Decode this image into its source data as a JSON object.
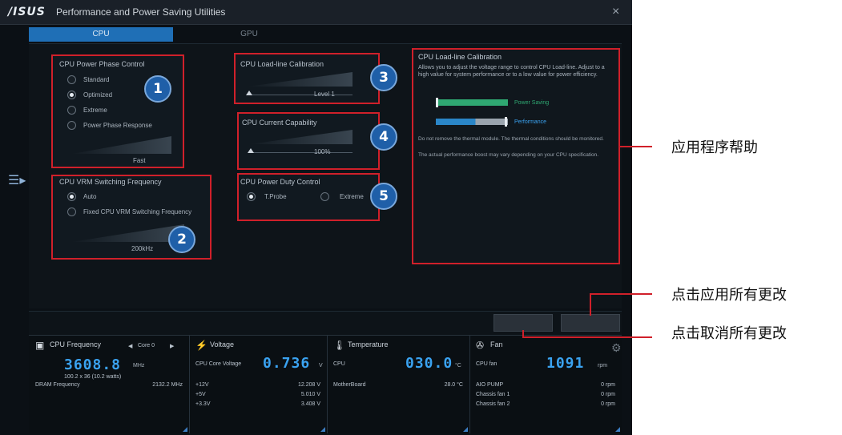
{
  "window": {
    "logo": "/ISUS",
    "title": "Performance and Power Saving Utilities",
    "close_glyph": "×"
  },
  "tabs": [
    {
      "label": "CPU",
      "active": true
    },
    {
      "label": "GPU",
      "active": false
    }
  ],
  "side_toggle_icon": "menu-expand-icon",
  "panels": {
    "phase_control": {
      "title": "CPU Power Phase Control",
      "options": [
        "Standard",
        "Optimized",
        "Extreme",
        "Power Phase Response"
      ],
      "selected": "Optimized",
      "slider_value": "Fast",
      "badge": "1"
    },
    "vrm_frequency": {
      "title": "CPU VRM Switching Frequency",
      "options": [
        "Auto",
        "Fixed CPU VRM Switching Frequency"
      ],
      "selected": "Auto",
      "slider_value": "200kHz",
      "badge": "2"
    },
    "load_line": {
      "title": "CPU Load-line Calibration",
      "slider_value": "Level 1",
      "badge": "3"
    },
    "current_capability": {
      "title": "CPU Current Capability",
      "slider_value": "100%",
      "badge": "4"
    },
    "duty_control": {
      "title": "CPU Power Duty Control",
      "options": [
        "T.Probe",
        "Extreme"
      ],
      "selected": "T.Probe",
      "badge": "5"
    }
  },
  "help": {
    "title": "CPU Load-line Calibration",
    "text": "Allows you to adjust the voltage range to control CPU Load-line. Adjust to a high value for system performance or to a low value for power efficiency.",
    "bar1_label": "Power Saving",
    "bar2_label": "Performance",
    "note1": "Do not remove the thermal module. The thermal conditions should be monitored.",
    "note2": "The actual performance boost may vary depending on your CPU specification.",
    "colors": {
      "power_saving": "#2fa872",
      "performance": "#2a86c8"
    }
  },
  "stats": {
    "cpu_freq": {
      "title": "CPU Frequency",
      "core_select": "Core 0",
      "value": "3608.8",
      "unit": "MHz",
      "sub": "100.2 x 36 (10.2 watts)",
      "rows": [
        {
          "label": "DRAM Frequency",
          "value": "2132.2 MHz"
        }
      ]
    },
    "voltage": {
      "title": "Voltage",
      "main_label": "CPU Core Voltage",
      "value": "0.736",
      "unit": "V",
      "rows": [
        {
          "label": "+12V",
          "value": "12.208 V"
        },
        {
          "label": "+5V",
          "value": "5.010 V"
        },
        {
          "label": "+3.3V",
          "value": "3.408 V"
        }
      ]
    },
    "temperature": {
      "title": "Temperature",
      "main_label": "CPU",
      "value": "030.0",
      "unit": "°C",
      "rows": [
        {
          "label": "MotherBoard",
          "value": "28.0 °C"
        }
      ]
    },
    "fan": {
      "title": "Fan",
      "main_label": "CPU fan",
      "value": "1091",
      "unit": "rpm",
      "rows": [
        {
          "label": "AIO PUMP",
          "value": "0 rpm"
        },
        {
          "label": "Chassis fan 1",
          "value": "0 rpm"
        },
        {
          "label": "Chassis fan 2",
          "value": "0 rpm"
        }
      ]
    }
  },
  "annotations": {
    "help": "应用程序帮助",
    "apply": "点击应用所有更改",
    "cancel": "点击取消所有更改"
  }
}
